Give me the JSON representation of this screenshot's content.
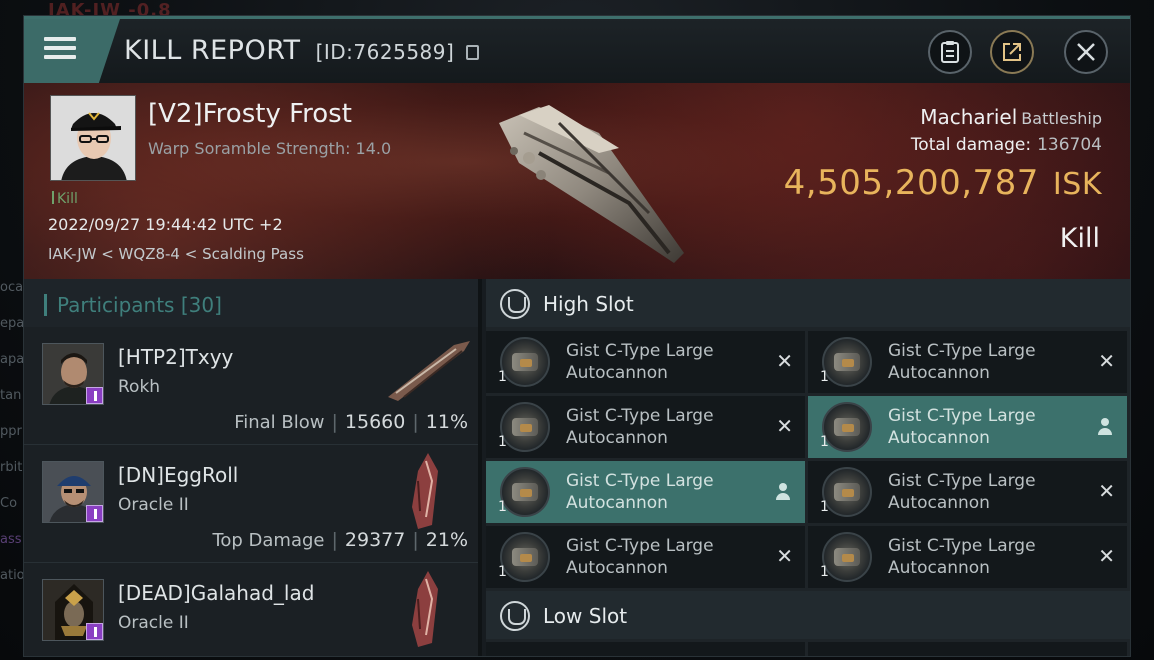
{
  "background": {
    "top_text": "IAK-JW -0.8",
    "left_fragments": [
      "oca",
      "epa",
      "apa",
      "tan",
      "ppr",
      "rbit",
      "Co",
      "ass",
      "atio"
    ]
  },
  "titlebar": {
    "title": "KILL REPORT",
    "report_id": "[ID:7625589]",
    "buttons": [
      "clipboard-icon",
      "share-icon",
      "close-icon"
    ]
  },
  "victim": {
    "name": "[V2]Frosty Frost",
    "warp_strength": "Warp Soramble Strength: 14.0",
    "kill_tag": "Kill",
    "datetime": "2022/09/27 19:44:42 UTC +2",
    "location": "IAK-JW < WQZ8-4 < Scalding Pass",
    "ship_name": "Machariel",
    "ship_class": "Battleship",
    "total_damage_label": "Total damage:",
    "total_damage": "136704",
    "isk_value": "4,505,200,787",
    "isk_unit": "ISK",
    "result": "Kill"
  },
  "participants": {
    "label": "Participants",
    "count": "[30]",
    "items": [
      {
        "name": "[HTP2]Txyy",
        "ship": "Rokh",
        "role": "Final Blow",
        "damage": "15660",
        "percent": "11%"
      },
      {
        "name": "[DN]EggRoll",
        "ship": "Oracle II",
        "role": "Top Damage",
        "damage": "29377",
        "percent": "21%"
      },
      {
        "name": "[DEAD]Galahad_lad",
        "ship": "Oracle II",
        "role": "",
        "damage": "",
        "percent": ""
      }
    ]
  },
  "slots": {
    "high_slot_label": "High Slot",
    "low_slot_label": "Low Slot",
    "high_modules": [
      {
        "line1": "Gist C-Type Large",
        "line2": "Autocannon",
        "qty": "1",
        "status": "destroyed",
        "highlighted": false
      },
      {
        "line1": "Gist C-Type Large",
        "line2": "Autocannon",
        "qty": "1",
        "status": "destroyed",
        "highlighted": false
      },
      {
        "line1": "Gist C-Type Large",
        "line2": "Autocannon",
        "qty": "1",
        "status": "destroyed",
        "highlighted": false
      },
      {
        "line1": "Gist C-Type Large",
        "line2": "Autocannon",
        "qty": "1",
        "status": "dropped",
        "highlighted": true
      },
      {
        "line1": "Gist C-Type Large",
        "line2": "Autocannon",
        "qty": "1",
        "status": "dropped",
        "highlighted": true
      },
      {
        "line1": "Gist C-Type Large",
        "line2": "Autocannon",
        "qty": "1",
        "status": "destroyed",
        "highlighted": false
      },
      {
        "line1": "Gist C-Type Large",
        "line2": "Autocannon",
        "qty": "1",
        "status": "destroyed",
        "highlighted": false
      },
      {
        "line1": "Gist C-Type Large",
        "line2": "Autocannon",
        "qty": "1",
        "status": "destroyed",
        "highlighted": false
      }
    ]
  },
  "colors": {
    "accent": "#3c6b68",
    "isk": "#e8b45c",
    "kill_green": "#6fa16b",
    "highlight_row": "#3c716c"
  }
}
